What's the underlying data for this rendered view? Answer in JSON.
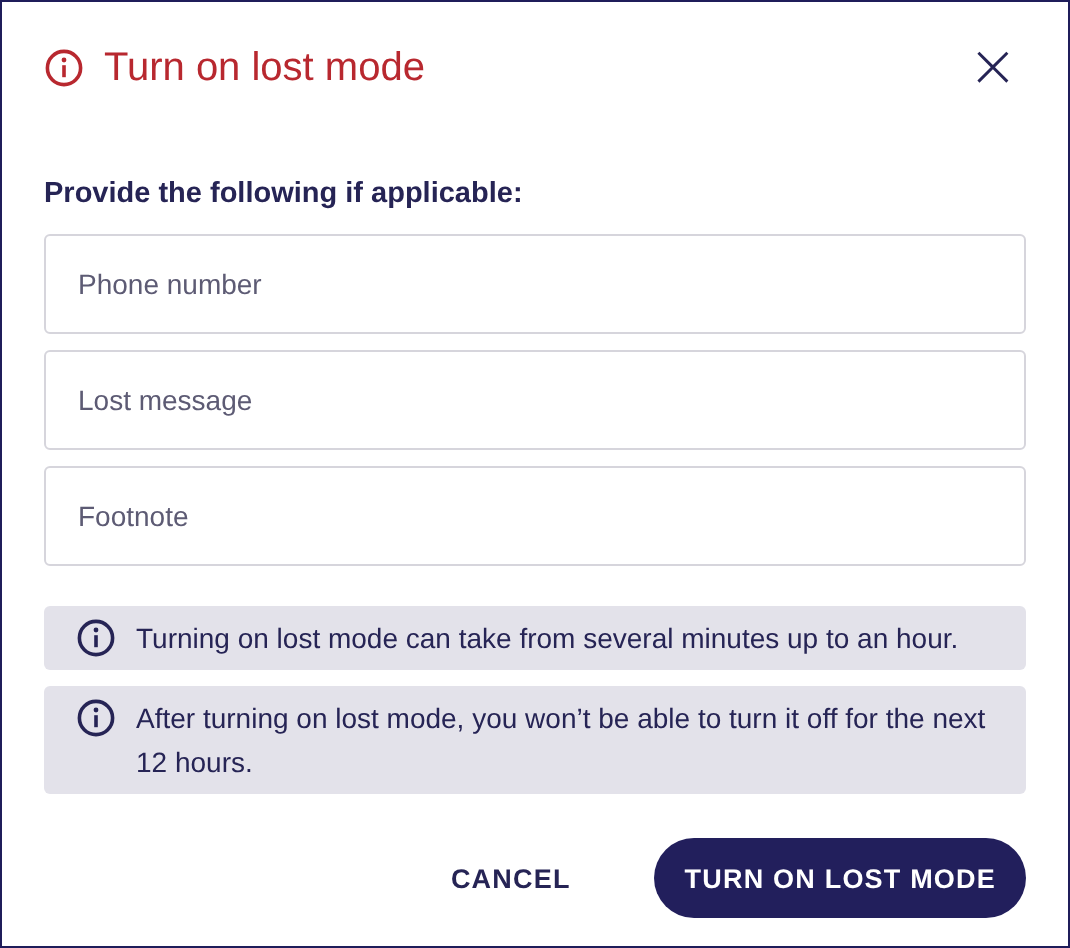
{
  "dialog": {
    "title": "Turn on lost mode",
    "close": "×"
  },
  "prompt": "Provide the following if applicable:",
  "fields": [
    {
      "placeholder": "Phone number"
    },
    {
      "placeholder": "Lost message"
    },
    {
      "placeholder": "Footnote"
    }
  ],
  "notes": [
    {
      "text": "Turning on lost mode can take from several minutes up to an hour."
    },
    {
      "text": "After turning on lost mode, you won’t be able to turn it off for the next 12 hours."
    }
  ],
  "buttons": [
    {
      "kind": "text",
      "label": "CANCEL"
    },
    {
      "kind": "primary",
      "label": "TURN ON LOST MODE"
    }
  ]
}
